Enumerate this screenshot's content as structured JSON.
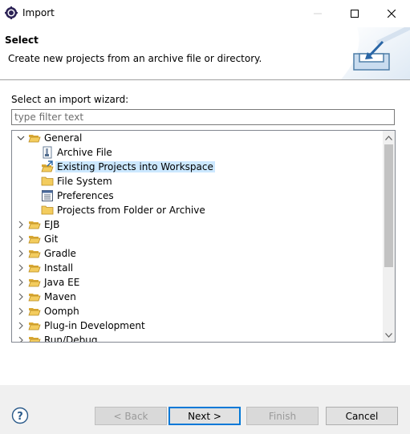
{
  "window": {
    "title": "Import",
    "icon": "eclipse-gear-icon",
    "controls": [
      "minimize-icon",
      "maximize-icon",
      "close-icon"
    ]
  },
  "banner": {
    "title": "Select",
    "message": "Create new projects from an archive file or directory.",
    "graphic": "import-tray-icon"
  },
  "main": {
    "wizard_label": "Select an import wizard:",
    "filter": {
      "value": "",
      "placeholder": "type filter text"
    }
  },
  "tree": {
    "items": [
      {
        "label": "General",
        "icon": "folder-open-icon",
        "expanded": true,
        "level": 0
      },
      {
        "label": "Archive File",
        "icon": "archive-file-icon",
        "level": 1
      },
      {
        "label": "Existing Projects into Workspace",
        "icon": "existing-projects-icon",
        "level": 1,
        "selected": true
      },
      {
        "label": "File System",
        "icon": "folder-icon",
        "level": 1
      },
      {
        "label": "Preferences",
        "icon": "preferences-icon",
        "level": 1
      },
      {
        "label": "Projects from Folder or Archive",
        "icon": "folder-icon",
        "level": 1
      },
      {
        "label": "EJB",
        "icon": "folder-icon",
        "expanded": false,
        "level": 0
      },
      {
        "label": "Git",
        "icon": "folder-icon",
        "expanded": false,
        "level": 0
      },
      {
        "label": "Gradle",
        "icon": "folder-icon",
        "expanded": false,
        "level": 0
      },
      {
        "label": "Install",
        "icon": "folder-icon",
        "expanded": false,
        "level": 0
      },
      {
        "label": "Java EE",
        "icon": "folder-icon",
        "expanded": false,
        "level": 0
      },
      {
        "label": "Maven",
        "icon": "folder-icon",
        "expanded": false,
        "level": 0
      },
      {
        "label": "Oomph",
        "icon": "folder-icon",
        "expanded": false,
        "level": 0
      },
      {
        "label": "Plug-in Development",
        "icon": "folder-icon",
        "expanded": false,
        "level": 0
      },
      {
        "label": "Run/Debug",
        "icon": "folder-icon",
        "expanded": false,
        "level": 0
      }
    ],
    "selection_color": "#cce8ff"
  },
  "buttons": {
    "help_icon": "help-icon",
    "back": "< Back",
    "next": "Next >",
    "finish": "Finish",
    "cancel": "Cancel"
  }
}
